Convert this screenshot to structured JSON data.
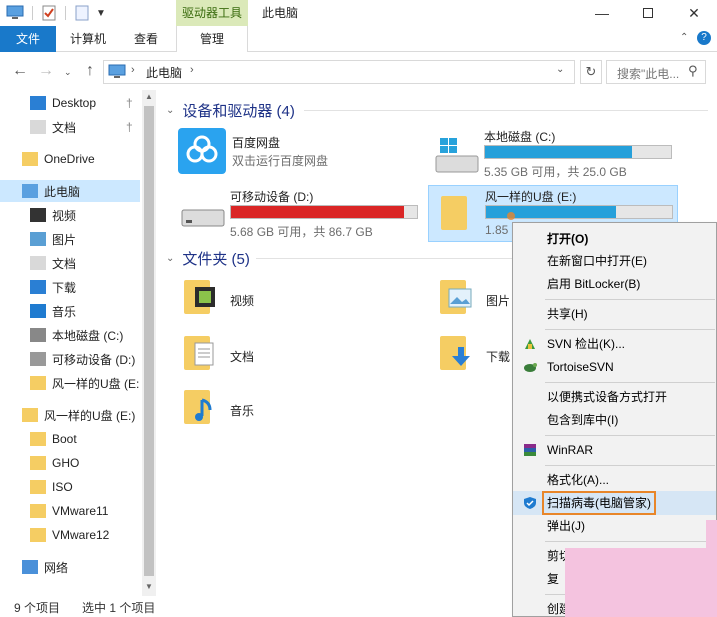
{
  "window": {
    "title": "此电脑",
    "contextual_tab": "驱动器工具",
    "minimize_icon": "minimize-icon",
    "maximize_icon": "maximize-icon",
    "close_icon": "close-icon"
  },
  "ribbon": {
    "file": "文件",
    "computer": "计算机",
    "view": "查看",
    "manage": "管理"
  },
  "address": {
    "path": "此电脑",
    "search_placeholder": "搜索\"此电..."
  },
  "nav": {
    "items": [
      {
        "label": "Desktop",
        "icon": "desktop-icon",
        "pinned": true
      },
      {
        "label": "文档",
        "icon": "documents-icon",
        "pinned": true
      },
      {
        "label": "OneDrive",
        "icon": "folder-icon"
      },
      {
        "label": "此电脑",
        "icon": "computer-icon",
        "selected": true
      },
      {
        "label": "视频",
        "icon": "videos-icon"
      },
      {
        "label": "图片",
        "icon": "pictures-icon"
      },
      {
        "label": "文档",
        "icon": "documents-icon"
      },
      {
        "label": "下载",
        "icon": "downloads-icon"
      },
      {
        "label": "音乐",
        "icon": "music-icon"
      },
      {
        "label": "本地磁盘 (C:)",
        "icon": "drive-icon"
      },
      {
        "label": "可移动设备 (D:)",
        "icon": "removable-drive-icon"
      },
      {
        "label": "风一样的U盘 (E:",
        "icon": "usb-drive-icon"
      },
      {
        "label": "风一样的U盘 (E:)",
        "icon": "usb-drive-icon"
      },
      {
        "label": "Boot",
        "icon": "folder-icon"
      },
      {
        "label": "GHO",
        "icon": "folder-icon"
      },
      {
        "label": "ISO",
        "icon": "folder-icon"
      },
      {
        "label": "VMware11",
        "icon": "folder-icon"
      },
      {
        "label": "VMware12",
        "icon": "folder-icon"
      },
      {
        "label": "网络",
        "icon": "network-icon"
      }
    ]
  },
  "devices": {
    "heading": "设备和驱动器 (4)",
    "baidu": {
      "name": "百度网盘",
      "sub": "双击运行百度网盘"
    },
    "c": {
      "name": "本地磁盘 (C:)",
      "sub": "5.35 GB 可用，共 25.0 GB",
      "used_fraction": 0.79,
      "color": "#26a0da"
    },
    "d": {
      "name": "可移动设备 (D:)",
      "sub": "5.68 GB 可用，共 86.7 GB",
      "used_fraction": 0.93,
      "color": "#da2626"
    },
    "e": {
      "name": "风一样的U盘 (E:)",
      "sub": "1.85",
      "used_fraction": 0.7,
      "color": "#26a0da"
    }
  },
  "folders": {
    "heading": "文件夹 (5)",
    "items": [
      "视频",
      "图片",
      "文档",
      "下载",
      "音乐"
    ]
  },
  "status": {
    "count": "9 个项目",
    "selected": "选中 1 个项目"
  },
  "menu": {
    "open": "打开(O)",
    "open_new": "在新窗口中打开(E)",
    "bitlocker": "启用 BitLocker(B)",
    "share": "共享(H)",
    "svn": "SVN 检出(K)...",
    "tortoise": "TortoiseSVN",
    "portable": "以便携式设备方式打开",
    "library": "包含到库中(I)",
    "winrar": "WinRAR",
    "format": "格式化(A)...",
    "scan": "扫描病毒(电脑管家)",
    "eject": "弹出(J)",
    "cut": "剪切",
    "copy": "复",
    "create": "创建"
  }
}
